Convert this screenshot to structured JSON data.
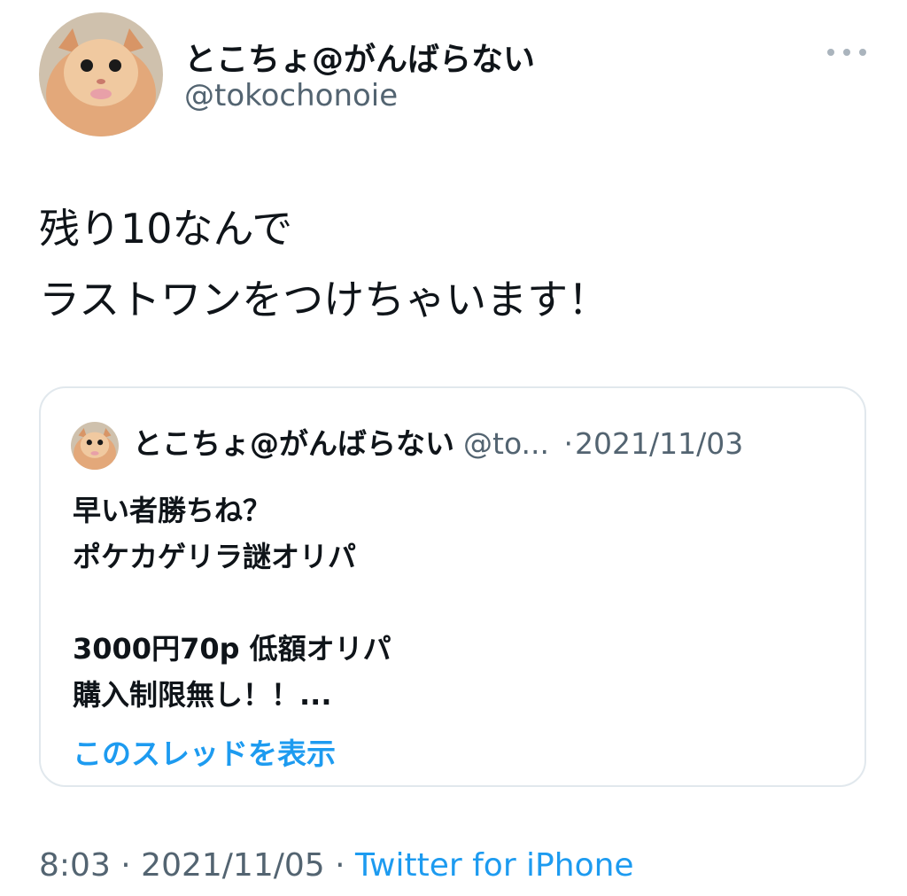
{
  "author": {
    "display_name": "とこちょ@がんばらない",
    "handle": "@tokochonoie"
  },
  "tweet": {
    "lines": [
      "残り10なんで",
      "ラストワンをつけちゃいます！"
    ]
  },
  "quoted_tweet": {
    "display_name": "とこちょ@がんばらない",
    "handle_truncated": "@to...",
    "separator": "·",
    "date": "2021/11/03",
    "lines": [
      "早い者勝ちね？",
      "ポケカゲリラ謎オリパ",
      "",
      "3000円70p  低額オリパ",
      "購入制限無し！！..."
    ],
    "show_thread_label": "このスレッドを表示"
  },
  "footer": {
    "time_date": "8:03 · 2021/11/05 ·",
    "source": "Twitter for iPhone"
  },
  "colors": {
    "link": "#1d9bf0",
    "secondary_text": "#536471",
    "border": "#e1e8ed"
  },
  "icons": {
    "more": "more-horizontal-icon"
  }
}
